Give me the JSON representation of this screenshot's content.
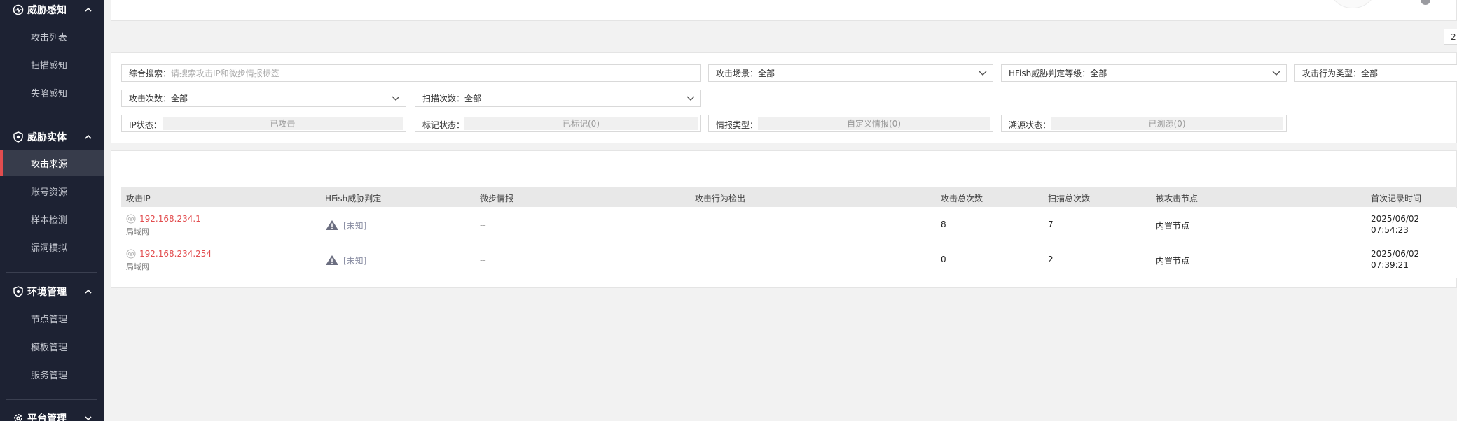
{
  "sidebar": {
    "sections": [
      {
        "title": "威胁感知",
        "icon": "threat-radar-icon",
        "expanded": true,
        "items": [
          {
            "label": "攻击列表"
          },
          {
            "label": "扫描感知"
          },
          {
            "label": "失陷感知"
          }
        ]
      },
      {
        "title": "威胁实体",
        "icon": "shield-icon",
        "expanded": true,
        "items": [
          {
            "label": "攻击来源",
            "active": true
          },
          {
            "label": "账号资源"
          },
          {
            "label": "样本检测"
          },
          {
            "label": "漏洞模拟"
          }
        ]
      },
      {
        "title": "环境管理",
        "icon": "shield-icon",
        "expanded": true,
        "items": [
          {
            "label": "节点管理"
          },
          {
            "label": "模板管理"
          },
          {
            "label": "服务管理"
          }
        ]
      },
      {
        "title": "平台管理",
        "icon": "gear-icon",
        "expanded": false,
        "items": []
      }
    ]
  },
  "page_number": "2",
  "filters": {
    "search": {
      "label": "综合搜索：",
      "placeholder": "请搜索攻击IP和微步情报标签"
    },
    "scene": {
      "label": "攻击场景：",
      "value": "全部"
    },
    "level": {
      "label": "HFish威胁判定等级：",
      "value": "全部"
    },
    "behavior": {
      "label": "攻击行为类型：",
      "value": "全部"
    },
    "attack_count": {
      "label": "攻击次数：",
      "value": "全部"
    },
    "scan_count": {
      "label": "扫描次数：",
      "value": "全部"
    },
    "ip_status": {
      "label": "IP状态：",
      "value": "已攻击"
    },
    "mark_status": {
      "label": "标记状态：",
      "value": "已标记(0)"
    },
    "intel_type": {
      "label": "情报类型：",
      "value": "自定义情报(0)"
    },
    "trace_status": {
      "label": "溯源状态：",
      "value": "已溯源(0)"
    }
  },
  "table": {
    "columns": [
      "攻击IP",
      "HFish威胁判定",
      "微步情报",
      "攻击行为检出",
      "攻击总次数",
      "扫描总次数",
      "被攻击节点",
      "首次记录时间"
    ],
    "rows": [
      {
        "ip": "192.168.234.1",
        "region": "局域网",
        "verdict": "[未知]",
        "intel": "--",
        "behavior": "",
        "attack_total": "8",
        "scan_total": "7",
        "node": "内置节点",
        "date": "2025/06/02",
        "time": "07:54:23"
      },
      {
        "ip": "192.168.234.254",
        "region": "局域网",
        "verdict": "[未知]",
        "intel": "--",
        "behavior": "",
        "attack_total": "0",
        "scan_total": "2",
        "node": "内置节点",
        "date": "2025/06/02",
        "time": "07:39:21"
      }
    ]
  },
  "colors": {
    "accent": "#e24d4f",
    "sidebar_bg": "#1d2233",
    "active_bg": "#373c4b"
  }
}
